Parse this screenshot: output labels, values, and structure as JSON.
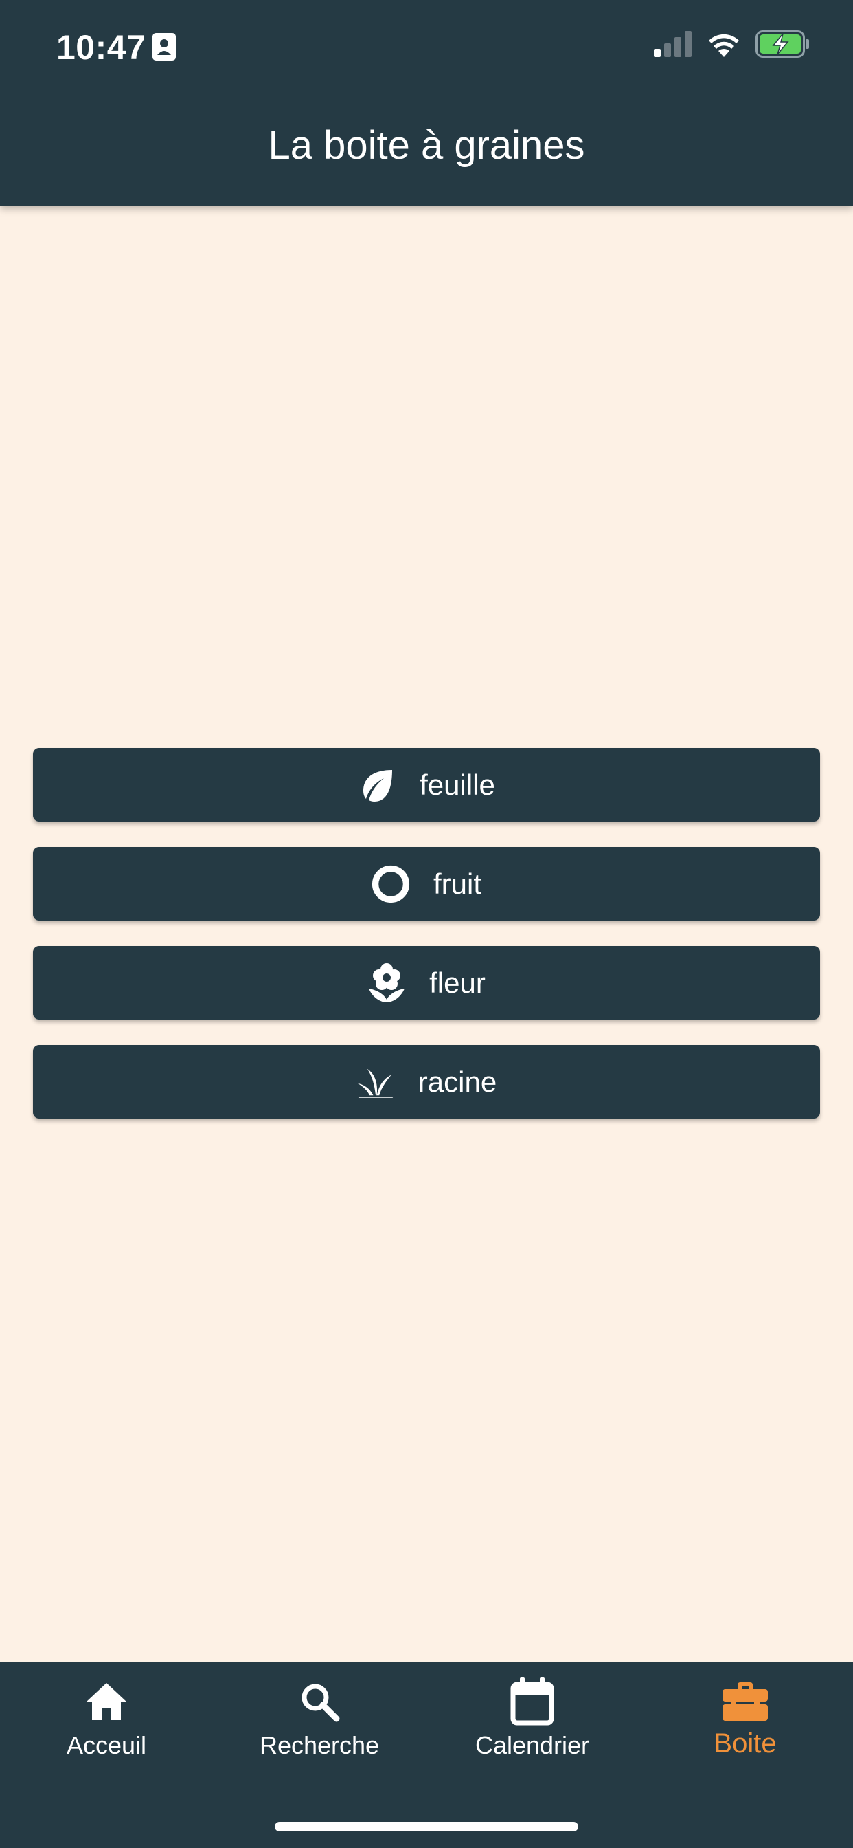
{
  "status_bar": {
    "time": "10:47"
  },
  "header": {
    "title": "La boite à graines"
  },
  "categories": [
    {
      "label": "feuille",
      "icon": "leaf-icon"
    },
    {
      "label": "fruit",
      "icon": "ring-icon"
    },
    {
      "label": "fleur",
      "icon": "flower-icon"
    },
    {
      "label": "racine",
      "icon": "sprout-icon"
    }
  ],
  "bottom_nav": {
    "items": [
      {
        "label": "Acceuil",
        "icon": "home-icon",
        "active": false
      },
      {
        "label": "Recherche",
        "icon": "search-icon",
        "active": false
      },
      {
        "label": "Calendrier",
        "icon": "calendar-icon",
        "active": false
      },
      {
        "label": "Boite",
        "icon": "toolbox-icon",
        "active": true
      }
    ]
  },
  "colors": {
    "background": "#FDF1E5",
    "bar": "#253A44",
    "accent": "#F0913A",
    "battery": "#5FD15F"
  }
}
